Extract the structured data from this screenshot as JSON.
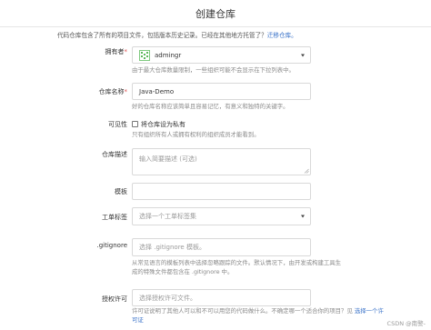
{
  "page": {
    "title": "创建仓库",
    "intro_text": "代码仓库包含了所有的项目文件，包括版本历史记录。已经在其他地方托管了？",
    "intro_link": "迁移仓库。"
  },
  "owner": {
    "label": "拥有者",
    "required_mark": "*",
    "value": "admingr",
    "help": "由于最大仓库数量限制，一些组织可能不会显示在下拉列表中。"
  },
  "repo_name": {
    "label": "仓库名称",
    "required_mark": "*",
    "value": "Java-Demo",
    "help": "好的仓库名称应该简单且容易记忆，有意义和独特的关键字。"
  },
  "visibility": {
    "label": "可见性",
    "checkbox_label": "将仓库设为私有",
    "checked": false,
    "help": "只有组织所有人或拥有权利的组织成员才能看到。"
  },
  "description": {
    "label": "仓库描述",
    "placeholder": "输入简要描述 (可选)"
  },
  "template": {
    "label": "模板",
    "value": ""
  },
  "issue_labels": {
    "label": "工单标签",
    "placeholder": "选择一个工单标签集"
  },
  "gitignore": {
    "label": ".gitignore",
    "placeholder": "选择 .gitignore 模板。",
    "help_line1": "从常见语言的模板列表中选择忽略跟踪的文件。默认情况下，由开发或构建工具生",
    "help_line2": "成的特殊文件都包含在 .gitignore 中。"
  },
  "license": {
    "label": "授权许可",
    "placeholder": "选择授权许可文件。",
    "help_text": "许可证说明了其他人可以和不可以用您的代码做什么。不确定哪一个适合你的项目？见",
    "help_link": "选择一个许可证"
  },
  "watermark": "CSDN @南警-",
  "colors": {
    "link": "#3b73c9",
    "required": "#e05252",
    "border": "#d9d9d9",
    "help_text": "#8a8a8a"
  }
}
